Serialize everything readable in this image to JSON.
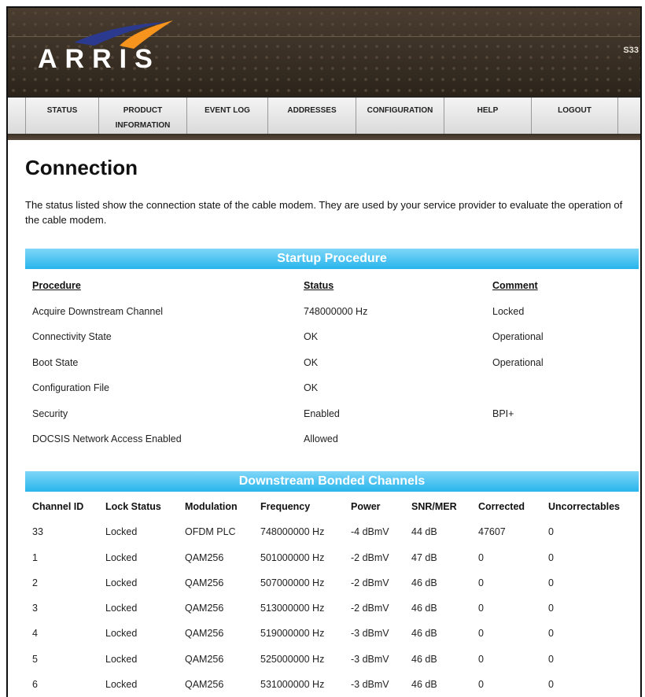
{
  "brand": {
    "logo": "ARRIS",
    "model": "S33"
  },
  "nav": {
    "items": [
      {
        "line1": "STATUS",
        "line2": ""
      },
      {
        "line1": "PRODUCT",
        "line2": "INFORMATION"
      },
      {
        "line1": "EVENT LOG",
        "line2": ""
      },
      {
        "line1": "ADDRESSES",
        "line2": ""
      },
      {
        "line1": "CONFIGURATION",
        "line2": ""
      },
      {
        "line1": "HELP",
        "line2": ""
      },
      {
        "line1": "LOGOUT",
        "line2": ""
      }
    ]
  },
  "page": {
    "title": "Connection",
    "description": "The status listed show the connection state of the cable modem. They are used by your service provider to evaluate the operation of the cable modem."
  },
  "startup": {
    "title": "Startup Procedure",
    "headers": [
      "Procedure",
      "Status",
      "Comment"
    ],
    "rows": [
      [
        "Acquire Downstream Channel",
        "748000000 Hz",
        "Locked"
      ],
      [
        "Connectivity State",
        "OK",
        "Operational"
      ],
      [
        "Boot State",
        "OK",
        "Operational"
      ],
      [
        "Configuration File",
        "OK",
        ""
      ],
      [
        "Security",
        "Enabled",
        "BPI+"
      ],
      [
        "DOCSIS Network Access Enabled",
        "Allowed",
        ""
      ]
    ]
  },
  "downstream": {
    "title": "Downstream Bonded Channels",
    "headers": [
      "Channel ID",
      "Lock Status",
      "Modulation",
      "Frequency",
      "Power",
      "SNR/MER",
      "Corrected",
      "Uncorrectables"
    ],
    "rows": [
      [
        "33",
        "Locked",
        "OFDM PLC",
        "748000000 Hz",
        "-4 dBmV",
        "44 dB",
        "47607",
        "0"
      ],
      [
        "1",
        "Locked",
        "QAM256",
        "501000000 Hz",
        "-2 dBmV",
        "47 dB",
        "0",
        "0"
      ],
      [
        "2",
        "Locked",
        "QAM256",
        "507000000 Hz",
        "-2 dBmV",
        "46 dB",
        "0",
        "0"
      ],
      [
        "3",
        "Locked",
        "QAM256",
        "513000000 Hz",
        "-2 dBmV",
        "46 dB",
        "0",
        "0"
      ],
      [
        "4",
        "Locked",
        "QAM256",
        "519000000 Hz",
        "-3 dBmV",
        "46 dB",
        "0",
        "0"
      ],
      [
        "5",
        "Locked",
        "QAM256",
        "525000000 Hz",
        "-3 dBmV",
        "46 dB",
        "0",
        "0"
      ],
      [
        "6",
        "Locked",
        "QAM256",
        "531000000 Hz",
        "-3 dBmV",
        "46 dB",
        "0",
        "0"
      ]
    ]
  },
  "colors": {
    "accent": "#28b5ec",
    "header_bg": "#3a2f24",
    "swoosh_orange": "#f7941d",
    "swoosh_blue": "#2b3a8f"
  }
}
